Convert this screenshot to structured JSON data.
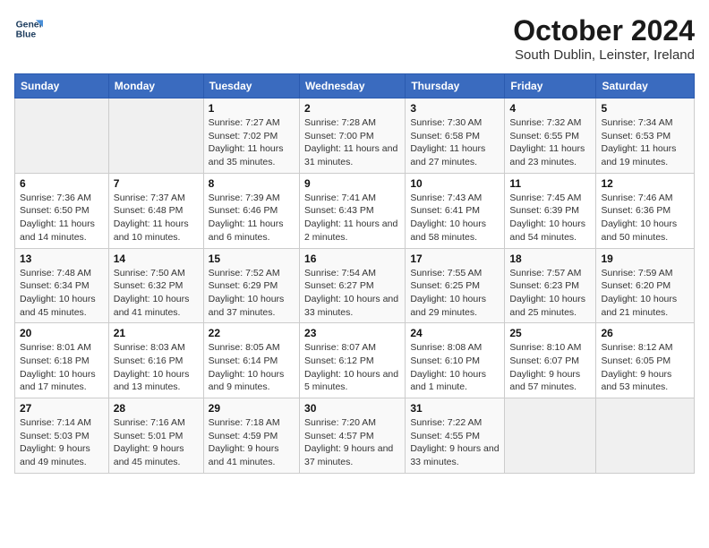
{
  "logo": {
    "line1": "General",
    "line2": "Blue"
  },
  "title": "October 2024",
  "subtitle": "South Dublin, Leinster, Ireland",
  "days_of_week": [
    "Sunday",
    "Monday",
    "Tuesday",
    "Wednesday",
    "Thursday",
    "Friday",
    "Saturday"
  ],
  "weeks": [
    [
      {
        "num": "",
        "sunrise": "",
        "sunset": "",
        "daylight": ""
      },
      {
        "num": "",
        "sunrise": "",
        "sunset": "",
        "daylight": ""
      },
      {
        "num": "1",
        "sunrise": "Sunrise: 7:27 AM",
        "sunset": "Sunset: 7:02 PM",
        "daylight": "Daylight: 11 hours and 35 minutes."
      },
      {
        "num": "2",
        "sunrise": "Sunrise: 7:28 AM",
        "sunset": "Sunset: 7:00 PM",
        "daylight": "Daylight: 11 hours and 31 minutes."
      },
      {
        "num": "3",
        "sunrise": "Sunrise: 7:30 AM",
        "sunset": "Sunset: 6:58 PM",
        "daylight": "Daylight: 11 hours and 27 minutes."
      },
      {
        "num": "4",
        "sunrise": "Sunrise: 7:32 AM",
        "sunset": "Sunset: 6:55 PM",
        "daylight": "Daylight: 11 hours and 23 minutes."
      },
      {
        "num": "5",
        "sunrise": "Sunrise: 7:34 AM",
        "sunset": "Sunset: 6:53 PM",
        "daylight": "Daylight: 11 hours and 19 minutes."
      }
    ],
    [
      {
        "num": "6",
        "sunrise": "Sunrise: 7:36 AM",
        "sunset": "Sunset: 6:50 PM",
        "daylight": "Daylight: 11 hours and 14 minutes."
      },
      {
        "num": "7",
        "sunrise": "Sunrise: 7:37 AM",
        "sunset": "Sunset: 6:48 PM",
        "daylight": "Daylight: 11 hours and 10 minutes."
      },
      {
        "num": "8",
        "sunrise": "Sunrise: 7:39 AM",
        "sunset": "Sunset: 6:46 PM",
        "daylight": "Daylight: 11 hours and 6 minutes."
      },
      {
        "num": "9",
        "sunrise": "Sunrise: 7:41 AM",
        "sunset": "Sunset: 6:43 PM",
        "daylight": "Daylight: 11 hours and 2 minutes."
      },
      {
        "num": "10",
        "sunrise": "Sunrise: 7:43 AM",
        "sunset": "Sunset: 6:41 PM",
        "daylight": "Daylight: 10 hours and 58 minutes."
      },
      {
        "num": "11",
        "sunrise": "Sunrise: 7:45 AM",
        "sunset": "Sunset: 6:39 PM",
        "daylight": "Daylight: 10 hours and 54 minutes."
      },
      {
        "num": "12",
        "sunrise": "Sunrise: 7:46 AM",
        "sunset": "Sunset: 6:36 PM",
        "daylight": "Daylight: 10 hours and 50 minutes."
      }
    ],
    [
      {
        "num": "13",
        "sunrise": "Sunrise: 7:48 AM",
        "sunset": "Sunset: 6:34 PM",
        "daylight": "Daylight: 10 hours and 45 minutes."
      },
      {
        "num": "14",
        "sunrise": "Sunrise: 7:50 AM",
        "sunset": "Sunset: 6:32 PM",
        "daylight": "Daylight: 10 hours and 41 minutes."
      },
      {
        "num": "15",
        "sunrise": "Sunrise: 7:52 AM",
        "sunset": "Sunset: 6:29 PM",
        "daylight": "Daylight: 10 hours and 37 minutes."
      },
      {
        "num": "16",
        "sunrise": "Sunrise: 7:54 AM",
        "sunset": "Sunset: 6:27 PM",
        "daylight": "Daylight: 10 hours and 33 minutes."
      },
      {
        "num": "17",
        "sunrise": "Sunrise: 7:55 AM",
        "sunset": "Sunset: 6:25 PM",
        "daylight": "Daylight: 10 hours and 29 minutes."
      },
      {
        "num": "18",
        "sunrise": "Sunrise: 7:57 AM",
        "sunset": "Sunset: 6:23 PM",
        "daylight": "Daylight: 10 hours and 25 minutes."
      },
      {
        "num": "19",
        "sunrise": "Sunrise: 7:59 AM",
        "sunset": "Sunset: 6:20 PM",
        "daylight": "Daylight: 10 hours and 21 minutes."
      }
    ],
    [
      {
        "num": "20",
        "sunrise": "Sunrise: 8:01 AM",
        "sunset": "Sunset: 6:18 PM",
        "daylight": "Daylight: 10 hours and 17 minutes."
      },
      {
        "num": "21",
        "sunrise": "Sunrise: 8:03 AM",
        "sunset": "Sunset: 6:16 PM",
        "daylight": "Daylight: 10 hours and 13 minutes."
      },
      {
        "num": "22",
        "sunrise": "Sunrise: 8:05 AM",
        "sunset": "Sunset: 6:14 PM",
        "daylight": "Daylight: 10 hours and 9 minutes."
      },
      {
        "num": "23",
        "sunrise": "Sunrise: 8:07 AM",
        "sunset": "Sunset: 6:12 PM",
        "daylight": "Daylight: 10 hours and 5 minutes."
      },
      {
        "num": "24",
        "sunrise": "Sunrise: 8:08 AM",
        "sunset": "Sunset: 6:10 PM",
        "daylight": "Daylight: 10 hours and 1 minute."
      },
      {
        "num": "25",
        "sunrise": "Sunrise: 8:10 AM",
        "sunset": "Sunset: 6:07 PM",
        "daylight": "Daylight: 9 hours and 57 minutes."
      },
      {
        "num": "26",
        "sunrise": "Sunrise: 8:12 AM",
        "sunset": "Sunset: 6:05 PM",
        "daylight": "Daylight: 9 hours and 53 minutes."
      }
    ],
    [
      {
        "num": "27",
        "sunrise": "Sunrise: 7:14 AM",
        "sunset": "Sunset: 5:03 PM",
        "daylight": "Daylight: 9 hours and 49 minutes."
      },
      {
        "num": "28",
        "sunrise": "Sunrise: 7:16 AM",
        "sunset": "Sunset: 5:01 PM",
        "daylight": "Daylight: 9 hours and 45 minutes."
      },
      {
        "num": "29",
        "sunrise": "Sunrise: 7:18 AM",
        "sunset": "Sunset: 4:59 PM",
        "daylight": "Daylight: 9 hours and 41 minutes."
      },
      {
        "num": "30",
        "sunrise": "Sunrise: 7:20 AM",
        "sunset": "Sunset: 4:57 PM",
        "daylight": "Daylight: 9 hours and 37 minutes."
      },
      {
        "num": "31",
        "sunrise": "Sunrise: 7:22 AM",
        "sunset": "Sunset: 4:55 PM",
        "daylight": "Daylight: 9 hours and 33 minutes."
      },
      {
        "num": "",
        "sunrise": "",
        "sunset": "",
        "daylight": ""
      },
      {
        "num": "",
        "sunrise": "",
        "sunset": "",
        "daylight": ""
      }
    ]
  ]
}
